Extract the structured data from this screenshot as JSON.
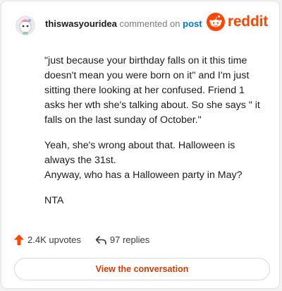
{
  "comment": {
    "author": "thiswasyouridea",
    "action_text": "commented on",
    "post_link": "post",
    "paragraphs": [
      "\"just because your birthday falls on it this time doesn't mean you were born on it\" and I'm just sitting there looking at her confused. Friend 1 asks her wth she's talking about. So she says \" it falls on the last sunday of October.\"",
      "Yeah, she's wrong about that. Halloween is always the 31st.\nAnyway, who has a Halloween party in May?",
      "NTA"
    ]
  },
  "brand": {
    "wordmark": "reddit",
    "color": "#ff4500",
    "icon": "reddit-snoo-icon"
  },
  "footer": {
    "upvotes": "2.4K upvotes",
    "replies": "97 replies",
    "upvote_icon": "upvote-arrow-icon",
    "reply_icon": "reply-arrow-icon"
  },
  "cta": {
    "label": "View the conversation"
  },
  "colors": {
    "upvote": "#ff4500",
    "link": "#0079d3",
    "cta_text": "#d93a00"
  }
}
